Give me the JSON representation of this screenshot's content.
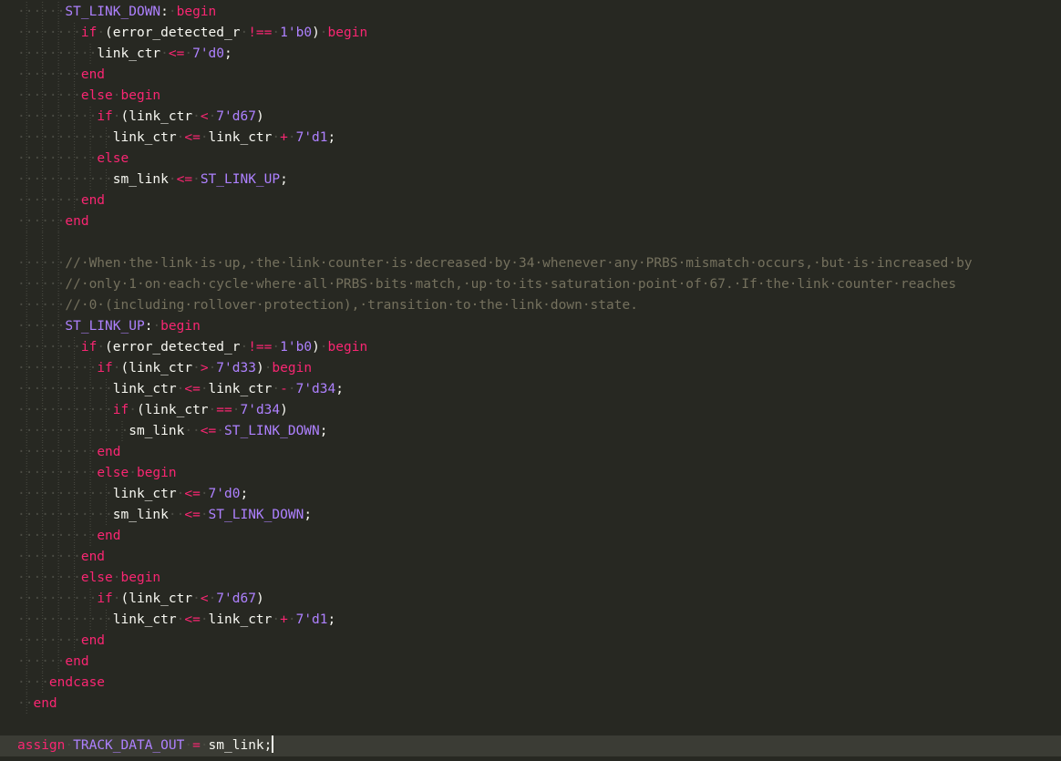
{
  "editor": {
    "language": "Verilog",
    "colors": {
      "background": "#272822",
      "keyword": "#f92672",
      "operator": "#f92672",
      "identifier": "#f8f8f2",
      "state_constant": "#ae81ff",
      "number": "#ae81ff",
      "comment": "#75715e",
      "current_line": "#3b3c35",
      "indent_guide": "#4a4b43"
    },
    "lines": [
      [
        [
          "ws",
          "······"
        ],
        [
          "st",
          "ST_LINK_DOWN"
        ],
        [
          "pn",
          ":"
        ],
        [
          "ws",
          "·"
        ],
        [
          "kw",
          "begin"
        ]
      ],
      [
        [
          "ws",
          "········"
        ],
        [
          "kw",
          "if"
        ],
        [
          "ws",
          "·"
        ],
        [
          "pn",
          "("
        ],
        [
          "id",
          "error_detected_r"
        ],
        [
          "ws",
          "·"
        ],
        [
          "op",
          "!=="
        ],
        [
          "ws",
          "·"
        ],
        [
          "num",
          "1'b0"
        ],
        [
          "pn",
          ")"
        ],
        [
          "ws",
          "·"
        ],
        [
          "kw",
          "begin"
        ]
      ],
      [
        [
          "ws",
          "··········"
        ],
        [
          "id",
          "link_ctr"
        ],
        [
          "ws",
          "·"
        ],
        [
          "op",
          "<="
        ],
        [
          "ws",
          "·"
        ],
        [
          "num",
          "7'd0"
        ],
        [
          "pn",
          ";"
        ]
      ],
      [
        [
          "ws",
          "········"
        ],
        [
          "kw",
          "end"
        ]
      ],
      [
        [
          "ws",
          "········"
        ],
        [
          "kw",
          "else"
        ],
        [
          "ws",
          "·"
        ],
        [
          "kw",
          "begin"
        ]
      ],
      [
        [
          "ws",
          "··········"
        ],
        [
          "kw",
          "if"
        ],
        [
          "ws",
          "·"
        ],
        [
          "pn",
          "("
        ],
        [
          "id",
          "link_ctr"
        ],
        [
          "ws",
          "·"
        ],
        [
          "op",
          "<"
        ],
        [
          "ws",
          "·"
        ],
        [
          "num",
          "7'd67"
        ],
        [
          "pn",
          ")"
        ]
      ],
      [
        [
          "ws",
          "············"
        ],
        [
          "id",
          "link_ctr"
        ],
        [
          "ws",
          "·"
        ],
        [
          "op",
          "<="
        ],
        [
          "ws",
          "·"
        ],
        [
          "id",
          "link_ctr"
        ],
        [
          "ws",
          "·"
        ],
        [
          "op",
          "+"
        ],
        [
          "ws",
          "·"
        ],
        [
          "num",
          "7'd1"
        ],
        [
          "pn",
          ";"
        ]
      ],
      [
        [
          "ws",
          "··········"
        ],
        [
          "kw",
          "else"
        ]
      ],
      [
        [
          "ws",
          "············"
        ],
        [
          "id",
          "sm_link"
        ],
        [
          "ws",
          "·"
        ],
        [
          "op",
          "<="
        ],
        [
          "ws",
          "·"
        ],
        [
          "st",
          "ST_LINK_UP"
        ],
        [
          "pn",
          ";"
        ]
      ],
      [
        [
          "ws",
          "········"
        ],
        [
          "kw",
          "end"
        ]
      ],
      [
        [
          "ws",
          "······"
        ],
        [
          "kw",
          "end"
        ]
      ],
      [],
      [
        [
          "ws",
          "······"
        ],
        [
          "cm",
          "//·When·the·link·is·up,·the·link·counter·is·decreased·by·34·whenever·any·PRBS·mismatch·occurs,·but·is·increased·by"
        ]
      ],
      [
        [
          "ws",
          "······"
        ],
        [
          "cm",
          "//·only·1·on·each·cycle·where·all·PRBS·bits·match,·up·to·its·saturation·point·of·67.·If·the·link·counter·reaches"
        ]
      ],
      [
        [
          "ws",
          "······"
        ],
        [
          "cm",
          "//·0·(including·rollover·protection),·transition·to·the·link·down·state."
        ]
      ],
      [
        [
          "ws",
          "······"
        ],
        [
          "st",
          "ST_LINK_UP"
        ],
        [
          "pn",
          ":"
        ],
        [
          "ws",
          "·"
        ],
        [
          "kw",
          "begin"
        ]
      ],
      [
        [
          "ws",
          "········"
        ],
        [
          "kw",
          "if"
        ],
        [
          "ws",
          "·"
        ],
        [
          "pn",
          "("
        ],
        [
          "id",
          "error_detected_r"
        ],
        [
          "ws",
          "·"
        ],
        [
          "op",
          "!=="
        ],
        [
          "ws",
          "·"
        ],
        [
          "num",
          "1'b0"
        ],
        [
          "pn",
          ")"
        ],
        [
          "ws",
          "·"
        ],
        [
          "kw",
          "begin"
        ]
      ],
      [
        [
          "ws",
          "··········"
        ],
        [
          "kw",
          "if"
        ],
        [
          "ws",
          "·"
        ],
        [
          "pn",
          "("
        ],
        [
          "id",
          "link_ctr"
        ],
        [
          "ws",
          "·"
        ],
        [
          "op",
          ">"
        ],
        [
          "ws",
          "·"
        ],
        [
          "num",
          "7'd33"
        ],
        [
          "pn",
          ")"
        ],
        [
          "ws",
          "·"
        ],
        [
          "kw",
          "begin"
        ]
      ],
      [
        [
          "ws",
          "············"
        ],
        [
          "id",
          "link_ctr"
        ],
        [
          "ws",
          "·"
        ],
        [
          "op",
          "<="
        ],
        [
          "ws",
          "·"
        ],
        [
          "id",
          "link_ctr"
        ],
        [
          "ws",
          "·"
        ],
        [
          "op",
          "-"
        ],
        [
          "ws",
          "·"
        ],
        [
          "num",
          "7'd34"
        ],
        [
          "pn",
          ";"
        ]
      ],
      [
        [
          "ws",
          "············"
        ],
        [
          "kw",
          "if"
        ],
        [
          "ws",
          "·"
        ],
        [
          "pn",
          "("
        ],
        [
          "id",
          "link_ctr"
        ],
        [
          "ws",
          "·"
        ],
        [
          "op",
          "=="
        ],
        [
          "ws",
          "·"
        ],
        [
          "num",
          "7'd34"
        ],
        [
          "pn",
          ")"
        ]
      ],
      [
        [
          "ws",
          "··············"
        ],
        [
          "id",
          "sm_link"
        ],
        [
          "ws",
          "··"
        ],
        [
          "op",
          "<="
        ],
        [
          "ws",
          "·"
        ],
        [
          "st",
          "ST_LINK_DOWN"
        ],
        [
          "pn",
          ";"
        ]
      ],
      [
        [
          "ws",
          "··········"
        ],
        [
          "kw",
          "end"
        ]
      ],
      [
        [
          "ws",
          "··········"
        ],
        [
          "kw",
          "else"
        ],
        [
          "ws",
          "·"
        ],
        [
          "kw",
          "begin"
        ]
      ],
      [
        [
          "ws",
          "············"
        ],
        [
          "id",
          "link_ctr"
        ],
        [
          "ws",
          "·"
        ],
        [
          "op",
          "<="
        ],
        [
          "ws",
          "·"
        ],
        [
          "num",
          "7'd0"
        ],
        [
          "pn",
          ";"
        ]
      ],
      [
        [
          "ws",
          "············"
        ],
        [
          "id",
          "sm_link"
        ],
        [
          "ws",
          "··"
        ],
        [
          "op",
          "<="
        ],
        [
          "ws",
          "·"
        ],
        [
          "st",
          "ST_LINK_DOWN"
        ],
        [
          "pn",
          ";"
        ]
      ],
      [
        [
          "ws",
          "··········"
        ],
        [
          "kw",
          "end"
        ]
      ],
      [
        [
          "ws",
          "········"
        ],
        [
          "kw",
          "end"
        ]
      ],
      [
        [
          "ws",
          "········"
        ],
        [
          "kw",
          "else"
        ],
        [
          "ws",
          "·"
        ],
        [
          "kw",
          "begin"
        ]
      ],
      [
        [
          "ws",
          "··········"
        ],
        [
          "kw",
          "if"
        ],
        [
          "ws",
          "·"
        ],
        [
          "pn",
          "("
        ],
        [
          "id",
          "link_ctr"
        ],
        [
          "ws",
          "·"
        ],
        [
          "op",
          "<"
        ],
        [
          "ws",
          "·"
        ],
        [
          "num",
          "7'd67"
        ],
        [
          "pn",
          ")"
        ]
      ],
      [
        [
          "ws",
          "············"
        ],
        [
          "id",
          "link_ctr"
        ],
        [
          "ws",
          "·"
        ],
        [
          "op",
          "<="
        ],
        [
          "ws",
          "·"
        ],
        [
          "id",
          "link_ctr"
        ],
        [
          "ws",
          "·"
        ],
        [
          "op",
          "+"
        ],
        [
          "ws",
          "·"
        ],
        [
          "num",
          "7'd1"
        ],
        [
          "pn",
          ";"
        ]
      ],
      [
        [
          "ws",
          "········"
        ],
        [
          "kw",
          "end"
        ]
      ],
      [
        [
          "ws",
          "······"
        ],
        [
          "kw",
          "end"
        ]
      ],
      [
        [
          "ws",
          "····"
        ],
        [
          "kw",
          "endcase"
        ]
      ],
      [
        [
          "ws",
          "··"
        ],
        [
          "kw",
          "end"
        ]
      ],
      [],
      [
        [
          "kw",
          "assign"
        ],
        [
          "ws",
          "·"
        ],
        [
          "st",
          "TRACK_DATA_OUT"
        ],
        [
          "ws",
          "·"
        ],
        [
          "op",
          "="
        ],
        [
          "ws",
          "·"
        ],
        [
          "id",
          "sm_link"
        ],
        [
          "pn",
          ";"
        ]
      ]
    ],
    "current_line_index": 35
  }
}
